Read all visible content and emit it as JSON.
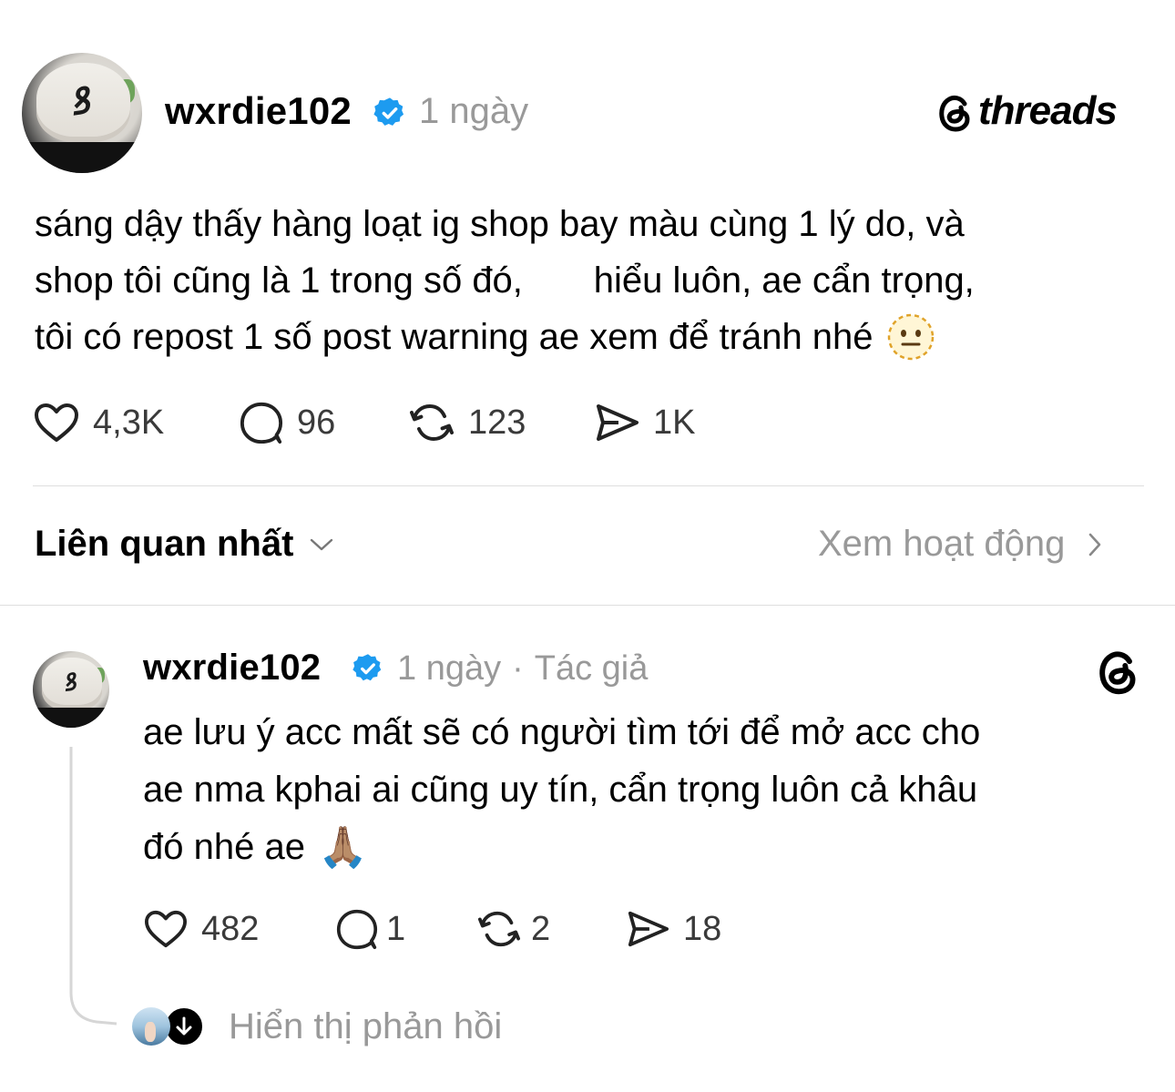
{
  "brand": {
    "name": "threads",
    "icon": "threads-logo-icon"
  },
  "post": {
    "author": "wxrdie102",
    "verified_icon": "verified-badge-icon",
    "time": "1 ngày",
    "lines": [
      "sáng dậy thấy hàng loạt ig shop bay màu cùng 1 lý do, và",
      "shop tôi cũng là 1 trong số đó,       hiểu luôn, ae cẩn trọng,",
      "tôi có repost 1 số post warning ae xem để tránh nhé"
    ],
    "emoji": "neutral-face-dotted-emoji",
    "likes": "4,3K",
    "comments": "96",
    "reposts": "123",
    "shares": "1K"
  },
  "sort": {
    "label": "Liên quan nhất",
    "activity_link": "Xem hoạt động"
  },
  "reply": {
    "author": "wxrdie102",
    "time": "1 ngày",
    "separator": "·",
    "tag": "Tác giả",
    "lines": [
      "ae lưu ý acc mất sẽ có người tìm tới để mở acc cho",
      "ae nma kphai ai cũng uy tín, cẩn trọng luôn cả khâu",
      "đó nhé ae"
    ],
    "emoji": "🙏🏽",
    "likes": "482",
    "comments": "1",
    "reposts": "2",
    "shares": "18",
    "show_replies": "Hiển thị phản hồi"
  },
  "colors": {
    "verified": "#1d9bf0",
    "muted": "#999999",
    "divider": "#dedede"
  }
}
